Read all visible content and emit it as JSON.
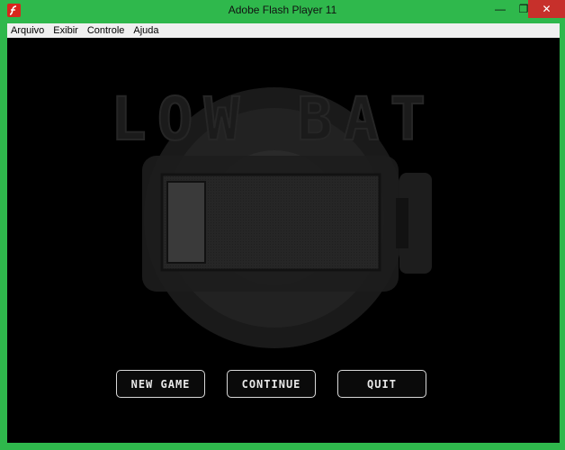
{
  "window": {
    "title": "Adobe Flash Player 11",
    "controls": {
      "minimize": "—",
      "maximize": "❐",
      "close": "✕"
    }
  },
  "menubar": {
    "items": [
      {
        "label": "Arquivo"
      },
      {
        "label": "Exibir"
      },
      {
        "label": "Controle"
      },
      {
        "label": "Ajuda"
      }
    ]
  },
  "game": {
    "title": "LOW BAT",
    "buttons": {
      "new_game": "NEW GAME",
      "continue": "CONTINUE",
      "quit": "QUIT"
    },
    "battery_level": 0.2
  },
  "colors": {
    "frame": "#2fb84c",
    "stage": "#000000",
    "button_border": "#d9d9d9"
  }
}
